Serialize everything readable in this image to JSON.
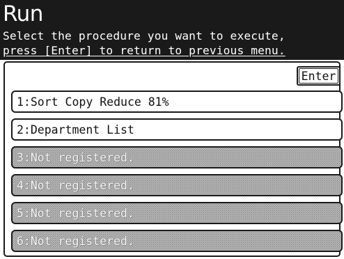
{
  "screen": {
    "title": "Run",
    "instructions": [
      "Select the procedure you want to execute,",
      "press [Enter] to return to previous menu."
    ],
    "enter_label": "Enter"
  },
  "procedures": [
    {
      "label": "1:Sort Copy Reduce 81%",
      "enabled": true
    },
    {
      "label": "2:Department List",
      "enabled": true
    },
    {
      "label": "3:Not registered.",
      "enabled": false
    },
    {
      "label": "4:Not registered.",
      "enabled": false
    },
    {
      "label": "5:Not registered.",
      "enabled": false
    },
    {
      "label": "6:Not registered.",
      "enabled": false
    }
  ],
  "colors": {
    "header_bg": "#1a1a1a",
    "header_text": "#ffffff",
    "button_border": "#1a1a1a",
    "disabled_fill": "#b8b8b8"
  }
}
